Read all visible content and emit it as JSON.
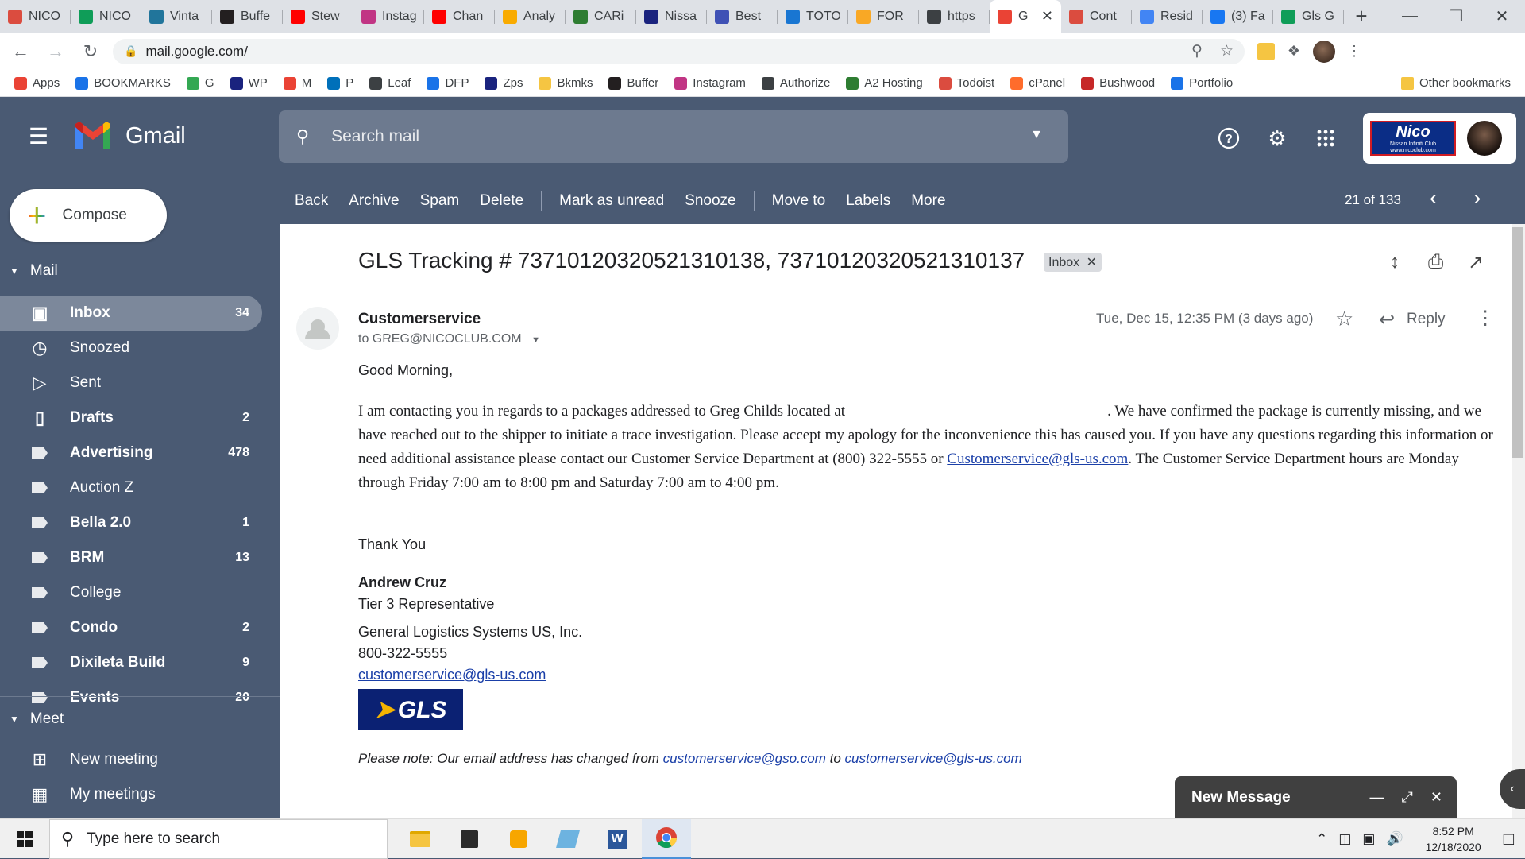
{
  "browser": {
    "tabs": [
      {
        "title": "NICO",
        "icon": "todoist-icon",
        "color": "#db4c3f"
      },
      {
        "title": "NICO",
        "icon": "sheets-icon",
        "color": "#0f9d58"
      },
      {
        "title": "Vinta",
        "icon": "wordpress-icon",
        "color": "#21759b"
      },
      {
        "title": "Buffe",
        "icon": "buffer-icon",
        "color": "#231f20"
      },
      {
        "title": "Stew",
        "icon": "youtube-icon",
        "color": "#ff0000"
      },
      {
        "title": "Instag",
        "icon": "instagram-icon",
        "color": "#c13584"
      },
      {
        "title": "Chan",
        "icon": "youtube-icon",
        "color": "#ff0000"
      },
      {
        "title": "Analy",
        "icon": "analytics-icon",
        "color": "#f9ab00"
      },
      {
        "title": "CARi",
        "icon": "carid-icon",
        "color": "#2e7d32"
      },
      {
        "title": "Nissa",
        "icon": "nissan-icon",
        "color": "#1a237e"
      },
      {
        "title": "Best",
        "icon": "best-icon",
        "color": "#3f51b5"
      },
      {
        "title": "TOTO",
        "icon": "toto-icon",
        "color": "#1976d2"
      },
      {
        "title": "FOR",
        "icon": "ford-icon",
        "color": "#f9a825"
      },
      {
        "title": "https",
        "icon": "gear-icon",
        "color": "#3c4043"
      },
      {
        "title": "G",
        "icon": "gmail-icon",
        "color": "#ea4335",
        "active": true
      },
      {
        "title": "Cont",
        "icon": "todoist-icon",
        "color": "#db4c3f"
      },
      {
        "title": "Resid",
        "icon": "google-icon",
        "color": "#4285f4"
      },
      {
        "title": "(3) Fa",
        "icon": "facebook-icon",
        "color": "#1877f2"
      },
      {
        "title": "Gls G",
        "icon": "star-icon",
        "color": "#0f9d58"
      }
    ],
    "url": "mail.google.com/",
    "bookmarks": [
      {
        "label": "Apps",
        "icon": "apps-icon",
        "color": "#ea4335"
      },
      {
        "label": "BOOKMARKS",
        "icon": "star-icon",
        "color": "#1a73e8"
      },
      {
        "label": "G",
        "icon": "g-icon",
        "color": "#34a853"
      },
      {
        "label": "WP",
        "icon": "wp-icon",
        "color": "#1a237e"
      },
      {
        "label": "M",
        "icon": "gmail-icon",
        "color": "#ea4335"
      },
      {
        "label": "P",
        "icon": "p-icon",
        "color": "#0070ba"
      },
      {
        "label": "Leaf",
        "icon": "leaf-icon",
        "color": "#3c4043"
      },
      {
        "label": "DFP",
        "icon": "dfp-icon",
        "color": "#1a73e8"
      },
      {
        "label": "Zps",
        "icon": "zps-icon",
        "color": "#1a237e"
      },
      {
        "label": "Bkmks",
        "icon": "folder-icon",
        "color": "#f5c542"
      },
      {
        "label": "Buffer",
        "icon": "buffer-icon",
        "color": "#231f20"
      },
      {
        "label": "Instagram",
        "icon": "instagram-icon",
        "color": "#c13584"
      },
      {
        "label": "Authorize",
        "icon": "globe-icon",
        "color": "#3c4043"
      },
      {
        "label": "A2 Hosting",
        "icon": "a2-icon",
        "color": "#2e7d32"
      },
      {
        "label": "Todoist",
        "icon": "todoist-icon",
        "color": "#db4c3f"
      },
      {
        "label": "cPanel",
        "icon": "cpanel-icon",
        "color": "#ff6c2c"
      },
      {
        "label": "Bushwood",
        "icon": "nfl-icon",
        "color": "#c62828"
      },
      {
        "label": "Portfolio",
        "icon": "portfolio-icon",
        "color": "#1a73e8"
      }
    ],
    "other_bookmarks": "Other bookmarks"
  },
  "gmail": {
    "product_name": "Gmail",
    "search_placeholder": "Search mail",
    "account_logo": {
      "big": "Nico",
      "small1": "Nissan Infiniti Club",
      "small2": "www.nicoclub.com"
    },
    "compose_label": "Compose",
    "mail_section": "Mail",
    "meet_section": "Meet",
    "nav": [
      {
        "label": "Inbox",
        "count": "34",
        "icon": "inbox-icon",
        "active": true,
        "bold": true
      },
      {
        "label": "Snoozed",
        "count": "",
        "icon": "clock-icon"
      },
      {
        "label": "Sent",
        "count": "",
        "icon": "send-icon"
      },
      {
        "label": "Drafts",
        "count": "2",
        "icon": "draft-icon",
        "bold": true
      },
      {
        "label": "Advertising",
        "count": "478",
        "icon": "label-icon",
        "bold": true
      },
      {
        "label": "Auction Z",
        "count": "",
        "icon": "label-icon"
      },
      {
        "label": "Bella 2.0",
        "count": "1",
        "icon": "label-icon",
        "bold": true
      },
      {
        "label": "BRM",
        "count": "13",
        "icon": "label-icon",
        "bold": true
      },
      {
        "label": "College",
        "count": "",
        "icon": "label-icon"
      },
      {
        "label": "Condo",
        "count": "2",
        "icon": "label-icon",
        "bold": true
      },
      {
        "label": "Dixileta Build",
        "count": "9",
        "icon": "label-icon",
        "bold": true
      },
      {
        "label": "Events",
        "count": "20",
        "icon": "label-icon",
        "bold": true
      }
    ],
    "meet": [
      {
        "label": "New meeting",
        "icon": "video-plus-icon"
      },
      {
        "label": "My meetings",
        "icon": "calendar-icon"
      }
    ],
    "toolbar": {
      "back": "Back",
      "archive": "Archive",
      "spam": "Spam",
      "delete": "Delete",
      "mark_unread": "Mark as unread",
      "snooze": "Snooze",
      "move_to": "Move to",
      "labels": "Labels",
      "more": "More",
      "pager": "21 of 133"
    },
    "email": {
      "subject": "GLS Tracking # 737101203205213101­38, 73710120320521310137",
      "chip": "Inbox",
      "sender": "Customerservice",
      "recipient": "to GREG@NICOCLUB.COM",
      "date": "Tue, Dec 15, 12:35 PM (3 days ago)",
      "reply": "Reply",
      "greeting": "Good Morning,",
      "para_a": "I am contacting you in regards to a packages addressed to Greg Childs located at",
      "para_b": ".  We have confirmed the package is currently missing, and we have reached out to the shipper to initiate a trace investigation. Please accept my apology for the inconvenience this has caused you. If you have any questions regarding this information or need additional assistance please contact our Customer Service Department at (800) 322-5555 or ",
      "para_link": "Customerservice@gls-us.com",
      "para_c": ". The Customer Service Department hours are Monday through Friday 7:00 am to 8:00 pm and Saturday 7:00 am to 4:00 pm.",
      "thanks": "Thank You",
      "sig_name": "Andrew Cruz",
      "sig_title": "Tier 3 Representative",
      "sig_company": "General Logistics Systems US, Inc.",
      "sig_phone": "800-322-5555",
      "sig_email": "customerservice@gls-us.com",
      "logo_text": "GLS",
      "note_a": "Please note: Our email address has changed from ",
      "note_link1": "customerservice@gso.com",
      "note_b": " to ",
      "note_link2": "customerservice@gls-us.com"
    },
    "new_message": "New Message"
  },
  "taskbar": {
    "search_placeholder": "Type here to search",
    "time": "8:52 PM",
    "date": "12/18/2020"
  },
  "colors": {
    "gmail_bg": "#4a5a73",
    "active_nav": "#7c889b",
    "link": "#1a3fa8"
  }
}
